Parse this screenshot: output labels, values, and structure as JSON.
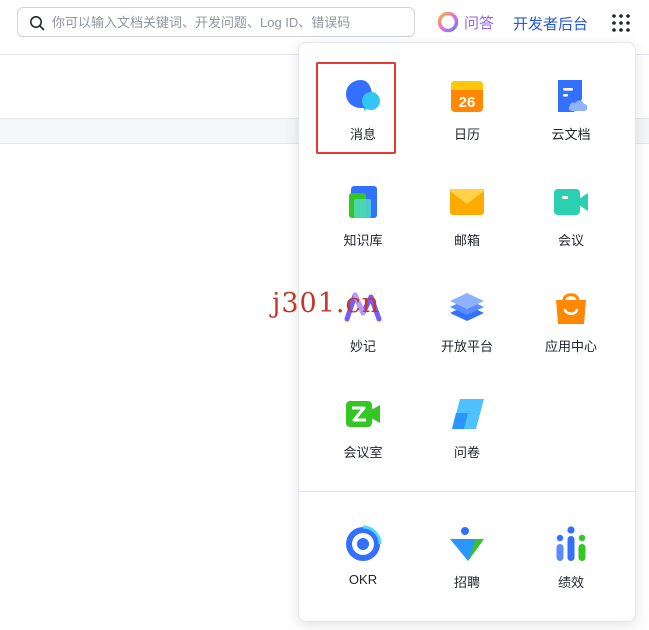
{
  "header": {
    "search_placeholder": "你可以输入文档关键词、开发问题、Log ID、错误码",
    "qa_label": "问答",
    "developer_console_label": "开发者后台"
  },
  "apps": [
    {
      "label": "消息",
      "icon": "message-icon"
    },
    {
      "label": "日历",
      "icon": "calendar-icon",
      "icon_text": "26"
    },
    {
      "label": "云文档",
      "icon": "cloud-docs-icon"
    },
    {
      "label": "知识库",
      "icon": "wiki-icon"
    },
    {
      "label": "邮箱",
      "icon": "mail-icon"
    },
    {
      "label": "会议",
      "icon": "meeting-icon"
    },
    {
      "label": "妙记",
      "icon": "minutes-icon"
    },
    {
      "label": "开放平台",
      "icon": "open-platform-icon"
    },
    {
      "label": "应用中心",
      "icon": "app-center-icon"
    },
    {
      "label": "会议室",
      "icon": "meeting-room-icon"
    },
    {
      "label": "问卷",
      "icon": "survey-icon"
    },
    {
      "label": "OKR",
      "icon": "okr-icon"
    },
    {
      "label": "招聘",
      "icon": "hire-icon"
    },
    {
      "label": "绩效",
      "icon": "performance-icon"
    }
  ],
  "watermark": "j301.cn",
  "colors": {
    "accent_blue": "#245bdb",
    "qa_purple": "#8d6be8",
    "highlight_red": "#e53935"
  }
}
